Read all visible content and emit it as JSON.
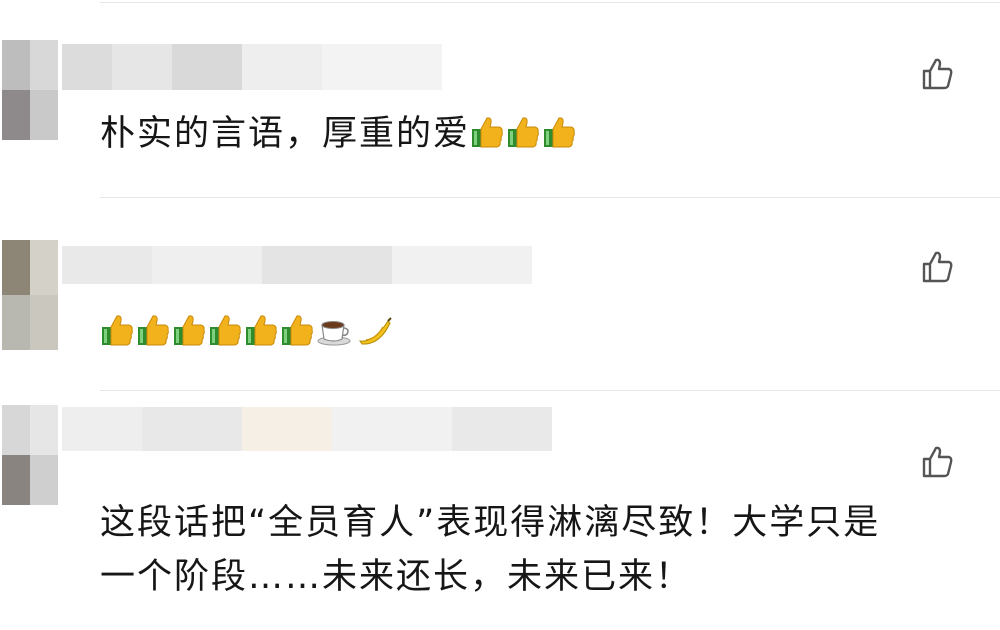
{
  "comments": [
    {
      "text": "朴实的言语，厚重的爱",
      "trailing_emoji": [
        "thumbs-up",
        "thumbs-up",
        "thumbs-up"
      ]
    },
    {
      "text": "",
      "emoji": [
        "thumbs-up",
        "thumbs-up",
        "thumbs-up",
        "thumbs-up",
        "thumbs-up",
        "thumbs-up",
        "coffee",
        "banana"
      ]
    },
    {
      "text_line1": "这段话把“全员育人”表现得淋漓尽致！大学只是",
      "text_line2": "一个阶段……未来还长，未来已来！"
    }
  ],
  "icons": {
    "like": "thumbs-up-outline-icon"
  },
  "colors": {
    "thumb_yellow": "#f2b21c",
    "cuff_green": "#2e8b2e",
    "like_icon_gray": "#555555",
    "divider": "#e6e6e6"
  }
}
